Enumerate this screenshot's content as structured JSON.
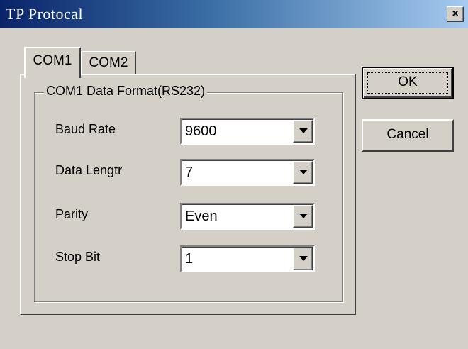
{
  "window": {
    "title": "TP Protocal",
    "close_glyph": "×"
  },
  "tabs": [
    {
      "label": "COM1",
      "selected": true
    },
    {
      "label": "COM2",
      "selected": false
    }
  ],
  "group": {
    "label": "COM1 Data Format(RS232)"
  },
  "fields": [
    {
      "label": "Baud Rate",
      "value": "9600"
    },
    {
      "label": "Data Lengtr",
      "value": "7"
    },
    {
      "label": "Parity",
      "value": "Even"
    },
    {
      "label": "Stop Bit",
      "value": "1"
    }
  ],
  "buttons": {
    "ok": "OK",
    "cancel": "Cancel"
  },
  "colors": {
    "face": "#d4d0c8",
    "title_start": "#0a246a",
    "title_end": "#a6caf0"
  }
}
